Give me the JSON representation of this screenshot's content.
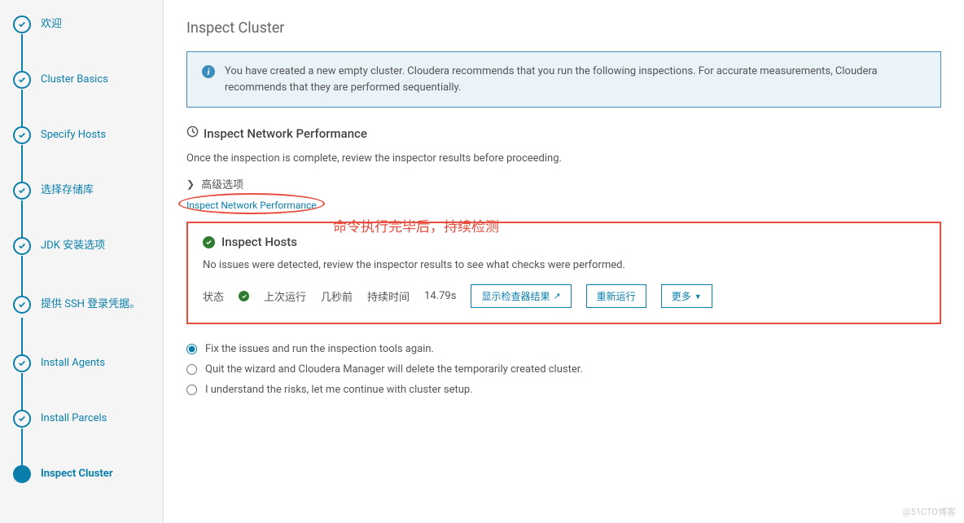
{
  "sidebar": {
    "steps": [
      {
        "label": "欢迎"
      },
      {
        "label": "Cluster Basics"
      },
      {
        "label": "Specify Hosts"
      },
      {
        "label": "选择存储库"
      },
      {
        "label": "JDK 安装选项"
      },
      {
        "label": "提供 SSH 登录凭据。"
      },
      {
        "label": "Install Agents"
      },
      {
        "label": "Install Parcels"
      },
      {
        "label": "Inspect Cluster"
      }
    ]
  },
  "main": {
    "title": "Inspect Cluster",
    "info_text": "You have created a new empty cluster. Cloudera recommends that you run the following inspections. For accurate measurements, Cloudera recommends that they are performed sequentially.",
    "network": {
      "title": "Inspect Network Performance",
      "desc": "Once the inspection is complete, review the inspector results before proceeding.",
      "advanced": "高级选项",
      "link": "Inspect Network Performance"
    },
    "annotation": "命令执行完毕后，持续检测",
    "hosts": {
      "title": "Inspect Hosts",
      "desc": "No issues were detected, review the inspector results to see what checks were performed.",
      "status_label": "状态",
      "last_run_label": "上次运行",
      "last_run_value": "几秒前",
      "duration_label": "持续时间",
      "duration_value": "14.79s",
      "btn_show": "显示检查器结果",
      "btn_rerun": "重新运行",
      "btn_more": "更多"
    },
    "radios": [
      {
        "label": "Fix the issues and run the inspection tools again."
      },
      {
        "label": "Quit the wizard and Cloudera Manager will delete the temporarily created cluster."
      },
      {
        "label": "I understand the risks, let me continue with cluster setup."
      }
    ]
  },
  "watermark": "@51CTO博客"
}
